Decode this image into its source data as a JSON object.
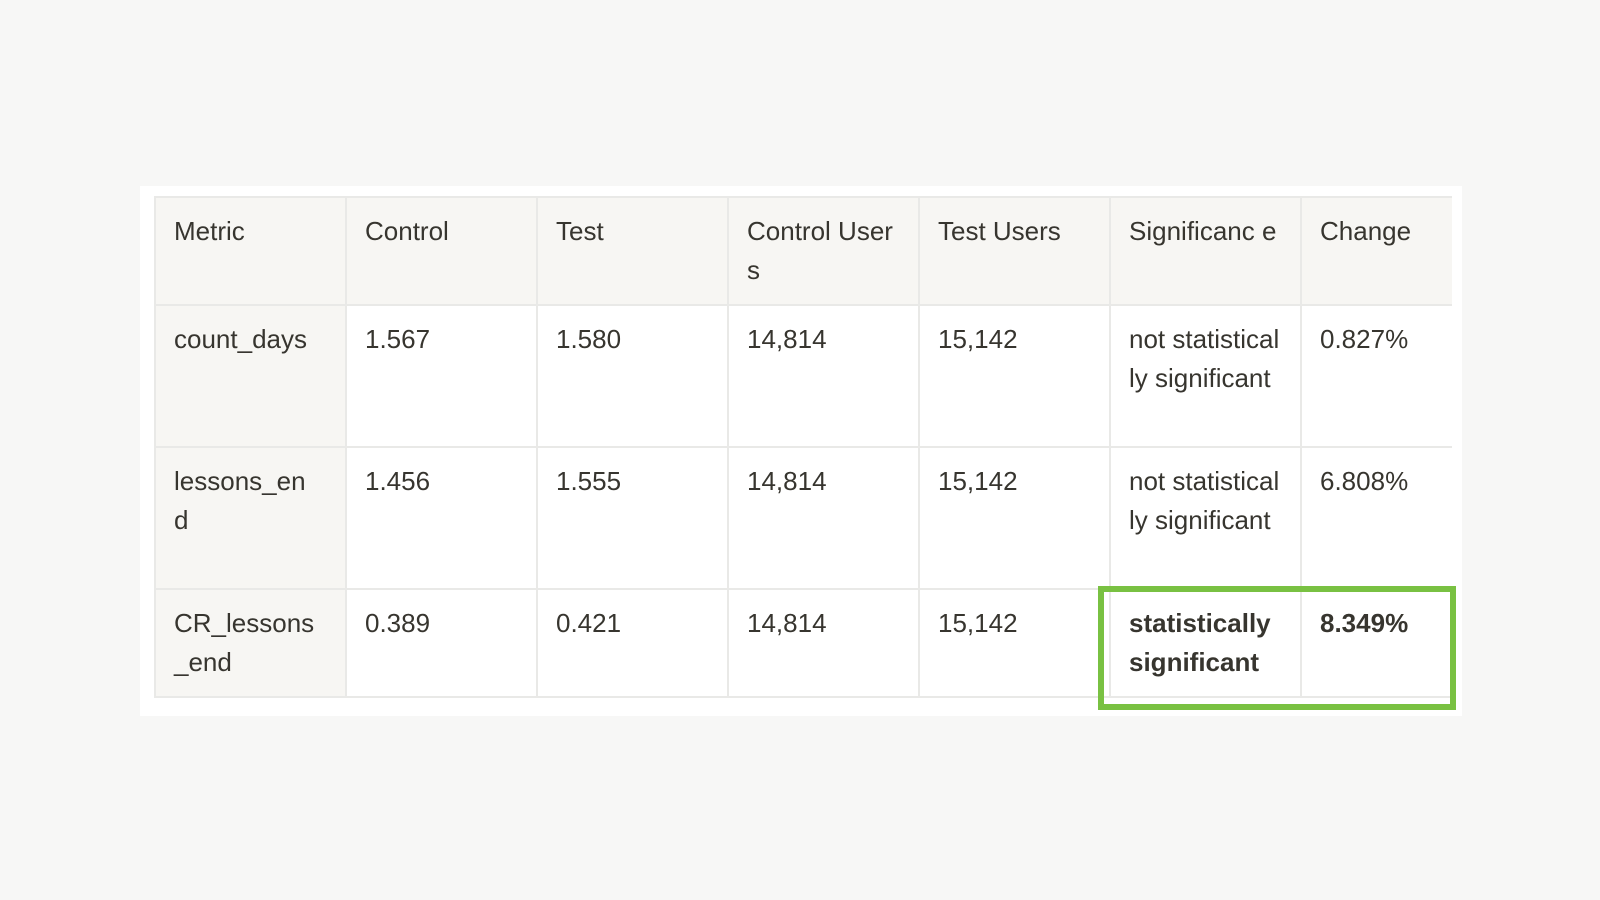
{
  "table": {
    "headers": [
      "Metric",
      "Control",
      "Test",
      "Control Users",
      "Test Users",
      "Significanc e",
      "Change"
    ],
    "rows": [
      {
        "metric": "count_days",
        "control": "1.567",
        "test": "1.580",
        "control_users": "14,814",
        "test_users": "15,142",
        "significance": "not statistically significant",
        "change": "0.827%"
      },
      {
        "metric": "lessons_en d",
        "control": "1.456",
        "test": "1.555",
        "control_users": "14,814",
        "test_users": "15,142",
        "significance": "not statistically significant",
        "change": "6.808%"
      },
      {
        "metric": "CR_lessons _end",
        "control": "0.389",
        "test": "0.421",
        "control_users": "14,814",
        "test_users": "15,142",
        "significance": "statistically significant",
        "change": "8.349%"
      }
    ]
  },
  "highlight": {
    "color": "#79c142"
  }
}
